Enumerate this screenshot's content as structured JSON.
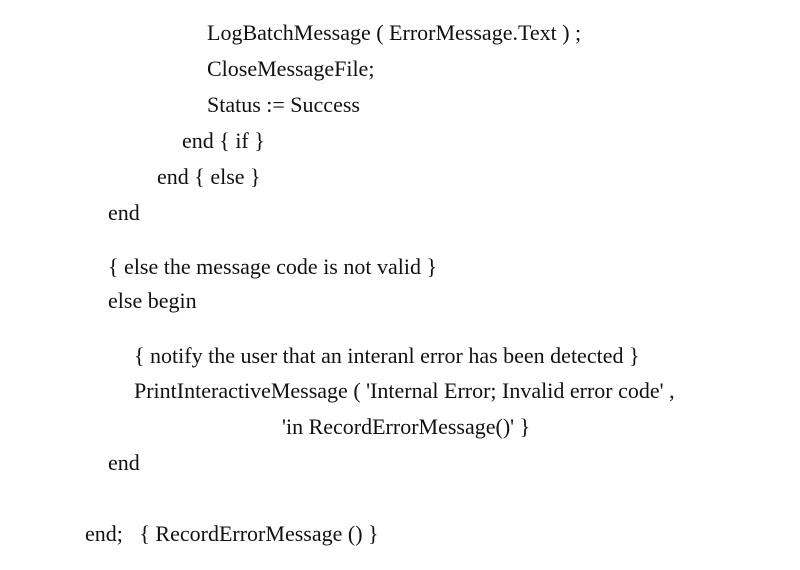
{
  "code_lines": [
    "LogBatchMessage ( ErrorMessage.Text ) ;",
    "CloseMessageFile;",
    "Status := Success",
    "end { if }",
    "end { else }",
    "end",
    "{ else the message code is not valid }",
    "else begin",
    "{ notify the user that an interanl error has been detected }",
    "PrintInteractiveMessage ( 'Internal Error; Invalid error code' ,",
    "'in RecordErrorMessage()' }",
    "end",
    "end;   { RecordErrorMessage () }"
  ]
}
